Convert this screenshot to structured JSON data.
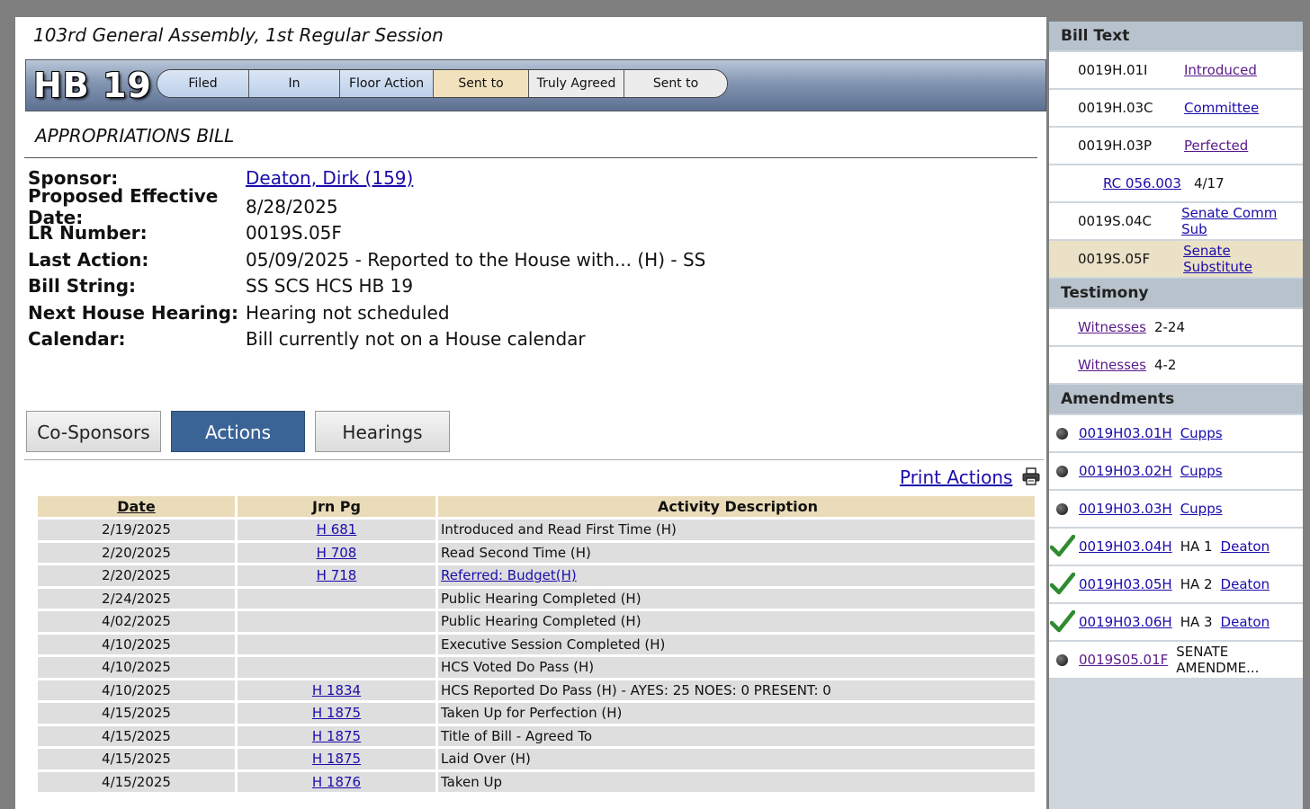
{
  "session": "103rd General Assembly, 1st Regular Session",
  "bill": {
    "number": "HB 19",
    "stages": [
      {
        "label": "Filed",
        "state": "done"
      },
      {
        "label": "In Committee",
        "state": "done"
      },
      {
        "label": "Floor Action",
        "state": "done"
      },
      {
        "label": "Sent to Senate",
        "state": "current"
      },
      {
        "label": "Truly Agreed",
        "state": "pending"
      },
      {
        "label": "Sent to Governor",
        "state": "pending"
      }
    ],
    "title": "APPROPRIATIONS BILL"
  },
  "info": {
    "sponsor_label": "Sponsor:",
    "sponsor": "Deaton, Dirk (159)",
    "effective_label": "Proposed Effective Date:",
    "effective": "8/28/2025",
    "lr_label": "LR Number:",
    "lr": "0019S.05F",
    "last_action_label": "Last Action:",
    "last_action": "05/09/2025 - Reported to the House with... (H) - SS",
    "bill_string_label": "Bill String:",
    "bill_string": "SS SCS HCS HB 19",
    "next_hearing_label": "Next House Hearing:",
    "next_hearing": "Hearing not scheduled",
    "calendar_label": "Calendar:",
    "calendar": "Bill currently not on a House calendar"
  },
  "tabs": {
    "cosponsors": "Co-Sponsors",
    "actions": "Actions",
    "hearings": "Hearings",
    "active": "Actions"
  },
  "print_actions": "Print Actions",
  "actions_table": {
    "headers": {
      "date": "Date",
      "jrn": "Jrn Pg",
      "desc": "Activity Description"
    },
    "rows": [
      {
        "date": "2/19/2025",
        "jrn": "H 681",
        "desc": "Introduced and Read First Time (H)"
      },
      {
        "date": "2/20/2025",
        "jrn": "H 708",
        "desc": "Read Second Time (H)"
      },
      {
        "date": "2/20/2025",
        "jrn": "H 718",
        "desc": "Referred: Budget(H)"
      },
      {
        "date": "2/24/2025",
        "jrn": "",
        "desc": "Public Hearing Completed (H)"
      },
      {
        "date": "4/02/2025",
        "jrn": "",
        "desc": "Public Hearing Completed (H)"
      },
      {
        "date": "4/10/2025",
        "jrn": "",
        "desc": "Executive Session Completed (H)"
      },
      {
        "date": "4/10/2025",
        "jrn": "",
        "desc": "HCS Voted Do Pass (H)"
      },
      {
        "date": "4/10/2025",
        "jrn": "H 1834",
        "desc": "HCS Reported Do Pass (H) - AYES: 25 NOES: 0 PRESENT: 0"
      },
      {
        "date": "4/15/2025",
        "jrn": "H 1875",
        "desc": "Taken Up for Perfection (H)"
      },
      {
        "date": "4/15/2025",
        "jrn": "H 1875",
        "desc": "Title of Bill - Agreed To"
      },
      {
        "date": "4/15/2025",
        "jrn": "H 1875",
        "desc": "Laid Over (H)"
      },
      {
        "date": "4/15/2025",
        "jrn": "H 1876",
        "desc": "Taken Up"
      }
    ]
  },
  "sidebar": {
    "bill_text_header": "Bill Text",
    "bill_text": [
      {
        "code": "0019H.01I",
        "label": "Introduced"
      },
      {
        "code": "0019H.03C",
        "label": "Committee"
      },
      {
        "code": "0019H.03P",
        "label": "Perfected"
      },
      {
        "rc": "RC 056.003",
        "rc_date": "4/17"
      },
      {
        "code": "0019S.04C",
        "label": "Senate Comm Sub"
      },
      {
        "code": "0019S.05F",
        "label": "Senate Substitute"
      }
    ],
    "testimony_header": "Testimony",
    "testimony": [
      {
        "label": "Witnesses",
        "date": "2-24"
      },
      {
        "label": "Witnesses",
        "date": "4-2"
      }
    ],
    "amendments_header": "Amendments",
    "amendments": [
      {
        "num": "0019H03.01H",
        "extra": "",
        "sponsor": "Cupps",
        "status": "pending"
      },
      {
        "num": "0019H03.02H",
        "extra": "",
        "sponsor": "Cupps",
        "status": "pending"
      },
      {
        "num": "0019H03.03H",
        "extra": "",
        "sponsor": "Cupps",
        "status": "pending"
      },
      {
        "num": "0019H03.04H",
        "extra": "HA 1",
        "sponsor": "Deaton",
        "status": "adopted"
      },
      {
        "num": "0019H03.05H",
        "extra": "HA 2",
        "sponsor": "Deaton",
        "status": "adopted"
      },
      {
        "num": "0019H03.06H",
        "extra": "HA 3",
        "sponsor": "Deaton",
        "status": "adopted"
      },
      {
        "num": "0019S05.01F",
        "extra": "SENATE AMENDME...",
        "sponsor": "",
        "status": "pending"
      }
    ]
  },
  "colors": {
    "accent_tab": "#3b6496",
    "current_stage": "#f1e2bd",
    "header_bar": "#8295b1",
    "adopted_check": "#2e8b2e"
  }
}
